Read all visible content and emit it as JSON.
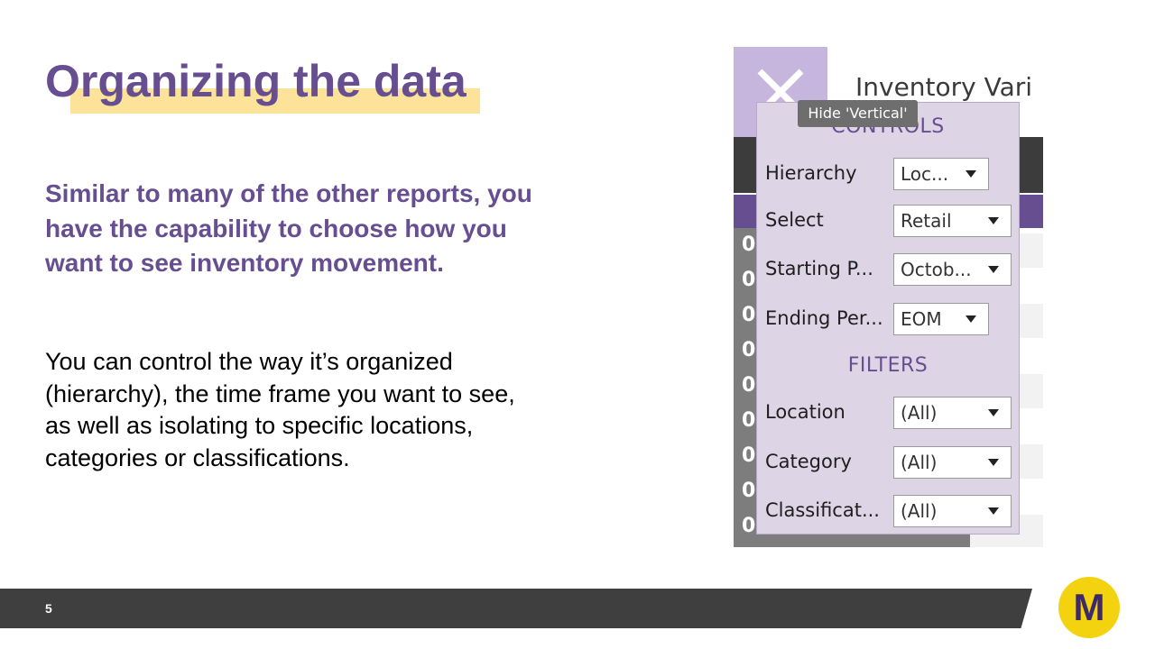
{
  "slide": {
    "title": "Organizing the data",
    "lead": "Similar to many of the other reports, you have the capability to choose how you want to see inventory movement.",
    "body": "You can control the way it’s organized (hierarchy), the time frame you want to see, as well as isolating to specific locations, categories or classifications.",
    "page_number": "5",
    "logo_letter": "M"
  },
  "screenshot": {
    "report_title": "Inventory Vari",
    "row_codes": [
      "0",
      "0",
      "0",
      "0",
      "0",
      "0",
      "0",
      "0",
      "0"
    ],
    "tooltip": "Hide 'Vertical'",
    "controls_heading": "CONTROLS",
    "filters_heading": "FILTERS",
    "controls": [
      {
        "label": "Hierarchy",
        "value": "Loc..."
      },
      {
        "label": "Select",
        "value": "Retail"
      },
      {
        "label": "Starting P...",
        "value": "Octob..."
      },
      {
        "label": "Ending Per...",
        "value": "EOM"
      }
    ],
    "filters": [
      {
        "label": "Location",
        "value": "(All)"
      },
      {
        "label": "Category",
        "value": "(All)"
      },
      {
        "label": "Classificat...",
        "value": "(All)"
      }
    ]
  },
  "colors": {
    "accent_purple": "#674e90",
    "highlight_yellow": "#fde39a",
    "logo_yellow": "#f3d20f",
    "footer_gray": "#3f3f3f"
  }
}
